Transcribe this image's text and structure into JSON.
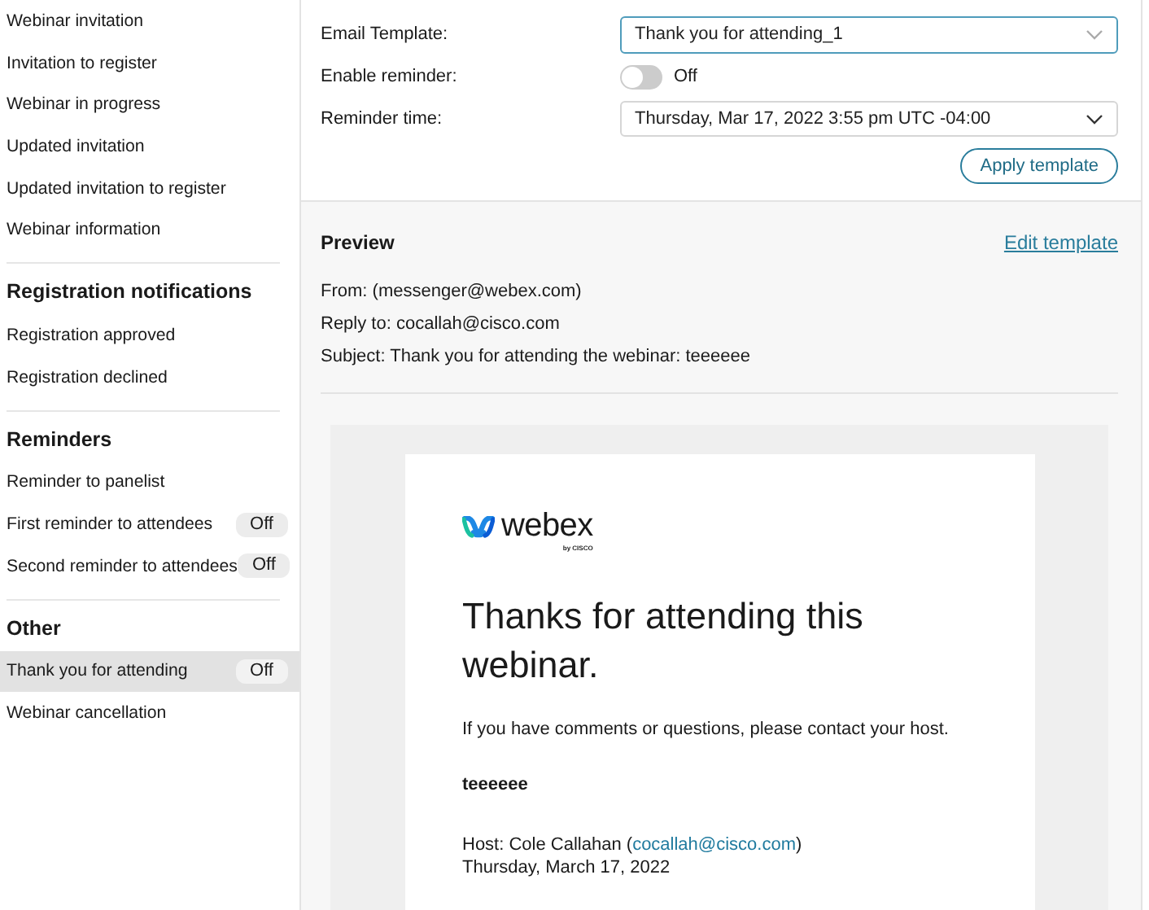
{
  "sidebar": {
    "sections": [
      {
        "items": [
          {
            "label": "Webinar invitation",
            "selected": false
          },
          {
            "label": "Invitation to register",
            "selected": false
          },
          {
            "label": "Webinar in progress",
            "selected": false
          },
          {
            "label": "Updated invitation",
            "selected": false
          },
          {
            "label": "Updated invitation to register",
            "selected": false
          },
          {
            "label": "Webinar information",
            "selected": false
          }
        ]
      },
      {
        "heading": "Registration notifications",
        "items": [
          {
            "label": "Registration approved",
            "selected": false
          },
          {
            "label": "Registration declined",
            "selected": false
          }
        ]
      },
      {
        "heading": "Reminders",
        "items": [
          {
            "label": "Reminder to panelist",
            "selected": false
          },
          {
            "label": "First reminder to attendees",
            "selected": false,
            "status": "Off"
          },
          {
            "label": "Second reminder to attendees",
            "selected": false,
            "status": "Off"
          }
        ]
      },
      {
        "heading": "Other",
        "items": [
          {
            "label": "Thank you for attending",
            "selected": true,
            "status": "Off"
          },
          {
            "label": "Webinar cancellation",
            "selected": false
          }
        ]
      }
    ]
  },
  "settings": {
    "email_template": {
      "label": "Email Template:",
      "value": "Thank you for attending_1"
    },
    "enable_reminder": {
      "label": "Enable reminder:",
      "on": false,
      "state_label": "Off"
    },
    "reminder_time": {
      "label": "Reminder time:",
      "value": "Thursday, Mar 17, 2022 3:55 pm UTC -04:00"
    },
    "apply_button": "Apply template"
  },
  "preview": {
    "title": "Preview",
    "edit_link": "Edit template",
    "headers": [
      "From: (messenger@webex.com)",
      "Reply to: cocallah@cisco.com",
      "Subject: Thank you for attending the webinar: teeeeee"
    ],
    "email": {
      "logo": {
        "name": "webex",
        "byline": "by CISCO"
      },
      "heading": "Thanks for attending this webinar.",
      "body": "If you have comments or questions, please contact your host.",
      "webinar_name": "teeeeee",
      "host": {
        "prefix": "Host: Cole Callahan (",
        "email": "cocallah@cisco.com",
        "suffix": ")"
      },
      "date": "Thursday, March 17, 2022"
    }
  }
}
